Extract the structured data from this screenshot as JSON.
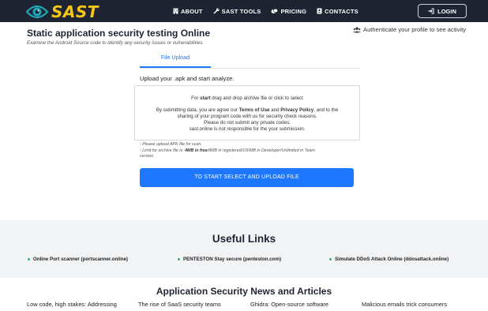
{
  "brand": {
    "name": "SAST",
    "accent": "#f5c518",
    "nav_bg": "#1e2431",
    "primary": "#1d77ff"
  },
  "nav": {
    "items": [
      {
        "label": "ABOUT",
        "icon": "building-icon"
      },
      {
        "label": "SAST TOOLS",
        "icon": "wrench-icon"
      },
      {
        "label": "PRICING",
        "icon": "coins-icon"
      },
      {
        "label": "CONTACTS",
        "icon": "address-book-icon"
      }
    ],
    "login_label": "LOGIN"
  },
  "header": {
    "title": "Static application security testing Online",
    "subtitle": "Examine the Android Source code to identify any security issues or vulnerabilities.",
    "auth_note": "Authenticate your profile to see activity"
  },
  "upload": {
    "tab_label": "File Upload",
    "intro": "Upload your .apk and start analyze.",
    "dropzone": {
      "line1_pre": "For ",
      "line1_bold": "start",
      "line1_post": " drag and drop archive file or click to select",
      "p1_pre": "By submitting data, you are agree our ",
      "terms": "Terms of Use",
      "and": " and ",
      "privacy": "Privacy Policy",
      "p1_post": ", and to the",
      "p2": "sharing of your program code with us for security check reasons.",
      "p3": "Please do not submit any private codes.",
      "p4": "sast.online is not responsible for the your submission."
    },
    "limit1": "- Please upload APK file for scan.",
    "limit2_pre": "- Limit for archive file is: ",
    "limit2_bold": "4MB in free",
    "limit2_post": "/8MB in registered/100MB in Developer/Unlimited in Team",
    "limit3": "version.",
    "button_label": "TO START SELECT AND UPLOAD FILE"
  },
  "useful_links": {
    "title": "Useful Links",
    "items": [
      {
        "label": "Online Port scanner (portscanner.online)"
      },
      {
        "label": "PENTESTON Stay secure (penteston.com)"
      },
      {
        "label": "Simulate DDoS Attack Online (ddosattack.online)"
      }
    ]
  },
  "news": {
    "title": "Application Security News and Articles",
    "items": [
      {
        "title": "Low code, high stakes: Addressing"
      },
      {
        "title": "The rise of SaaS security teams"
      },
      {
        "title": "Ghidra: Open-source software"
      },
      {
        "title": "Malicious emails trick consumers"
      }
    ]
  }
}
